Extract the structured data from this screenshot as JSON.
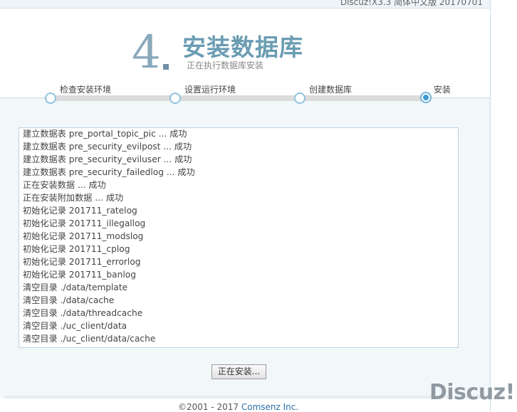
{
  "header": {
    "version": "Discuz!X3.3 简体中文版 20170701"
  },
  "step": {
    "number": "4",
    "title": "安装数据库",
    "subtitle": "正在执行数据库安装"
  },
  "steps": [
    {
      "label": "检查安装环境"
    },
    {
      "label": "设置运行环境"
    },
    {
      "label": "创建数据库"
    },
    {
      "label": "安装"
    }
  ],
  "log": [
    "建立数据表 pre_portal_topic_pic ... 成功",
    "建立数据表 pre_security_evilpost ... 成功",
    "建立数据表 pre_security_eviluser ... 成功",
    "建立数据表 pre_security_failedlog ... 成功",
    "正在安装数据 ... 成功",
    "正在安装附加数据 ... 成功",
    "初始化记录 201711_ratelog",
    "初始化记录 201711_illegallog",
    "初始化记录 201711_modslog",
    "初始化记录 201711_cplog",
    "初始化记录 201711_errorlog",
    "初始化记录 201711_banlog",
    "清空目录 ./data/template",
    "清空目录 ./data/cache",
    "清空目录 ./data/threadcache",
    "清空目录 ./uc_client/data",
    "清空目录 ./uc_client/data/cache"
  ],
  "button": {
    "install_label": "正在安装..."
  },
  "footer": {
    "copyright": "©2001 - 2017",
    "company": "Comsenz Inc."
  },
  "watermark": "Discuz!",
  "colors": {
    "accent": "#6a9cb2",
    "active_step": "#3d9bd3"
  }
}
